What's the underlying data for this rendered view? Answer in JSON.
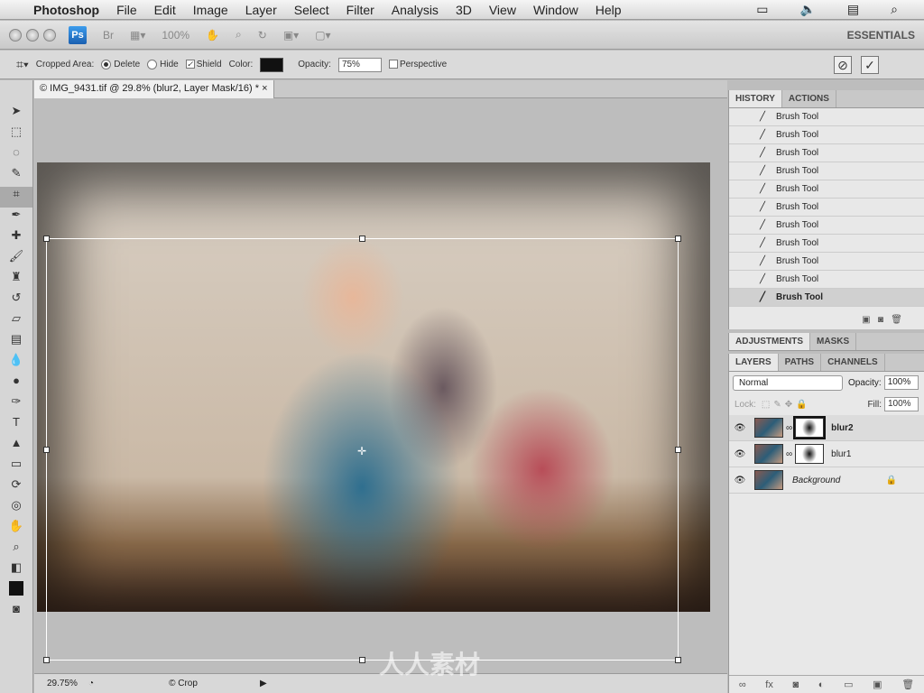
{
  "menubar": {
    "app": "Photoshop",
    "items": [
      "File",
      "Edit",
      "Image",
      "Layer",
      "Select",
      "Filter",
      "Analysis",
      "3D",
      "View",
      "Window",
      "Help"
    ]
  },
  "appbar": {
    "ps_logo": "Ps",
    "bridge": "Br",
    "zoom": "100%",
    "workspace": "ESSENTIALS"
  },
  "options": {
    "cropped_area_label": "Cropped Area:",
    "delete_label": "Delete",
    "hide_label": "Hide",
    "selected": "Delete",
    "shield_label": "Shield",
    "shield_checked": true,
    "color_label": "Color:",
    "shield_color": "#111111",
    "opacity_label": "Opacity:",
    "opacity_value": "75%",
    "perspective_label": "Perspective",
    "perspective_checked": false
  },
  "document": {
    "tab_title": "© IMG_9431.tif @ 29.8% (blur2, Layer Mask/16) *",
    "close": "×"
  },
  "status": {
    "zoom": "29.75%",
    "info": "© Crop"
  },
  "history": {
    "tabs": [
      "HISTORY",
      "ACTIONS"
    ],
    "items": [
      "Brush Tool",
      "Brush Tool",
      "Brush Tool",
      "Brush Tool",
      "Brush Tool",
      "Brush Tool",
      "Brush Tool",
      "Brush Tool",
      "Brush Tool",
      "Brush Tool",
      "Brush Tool"
    ]
  },
  "adjustments": {
    "tabs": [
      "ADJUSTMENTS",
      "MASKS"
    ]
  },
  "layers": {
    "tabs": [
      "LAYERS",
      "PATHS",
      "CHANNELS"
    ],
    "blend_mode": "Normal",
    "opacity_label": "Opacity:",
    "opacity": "100%",
    "lock_label": "Lock:",
    "fill_label": "Fill:",
    "fill": "100%",
    "items": [
      {
        "name": "blur2",
        "mask": true,
        "selected": true
      },
      {
        "name": "blur1",
        "mask": true,
        "selected": false
      },
      {
        "name": "Background",
        "mask": false,
        "locked": true
      }
    ]
  },
  "watermark": "人人素材"
}
